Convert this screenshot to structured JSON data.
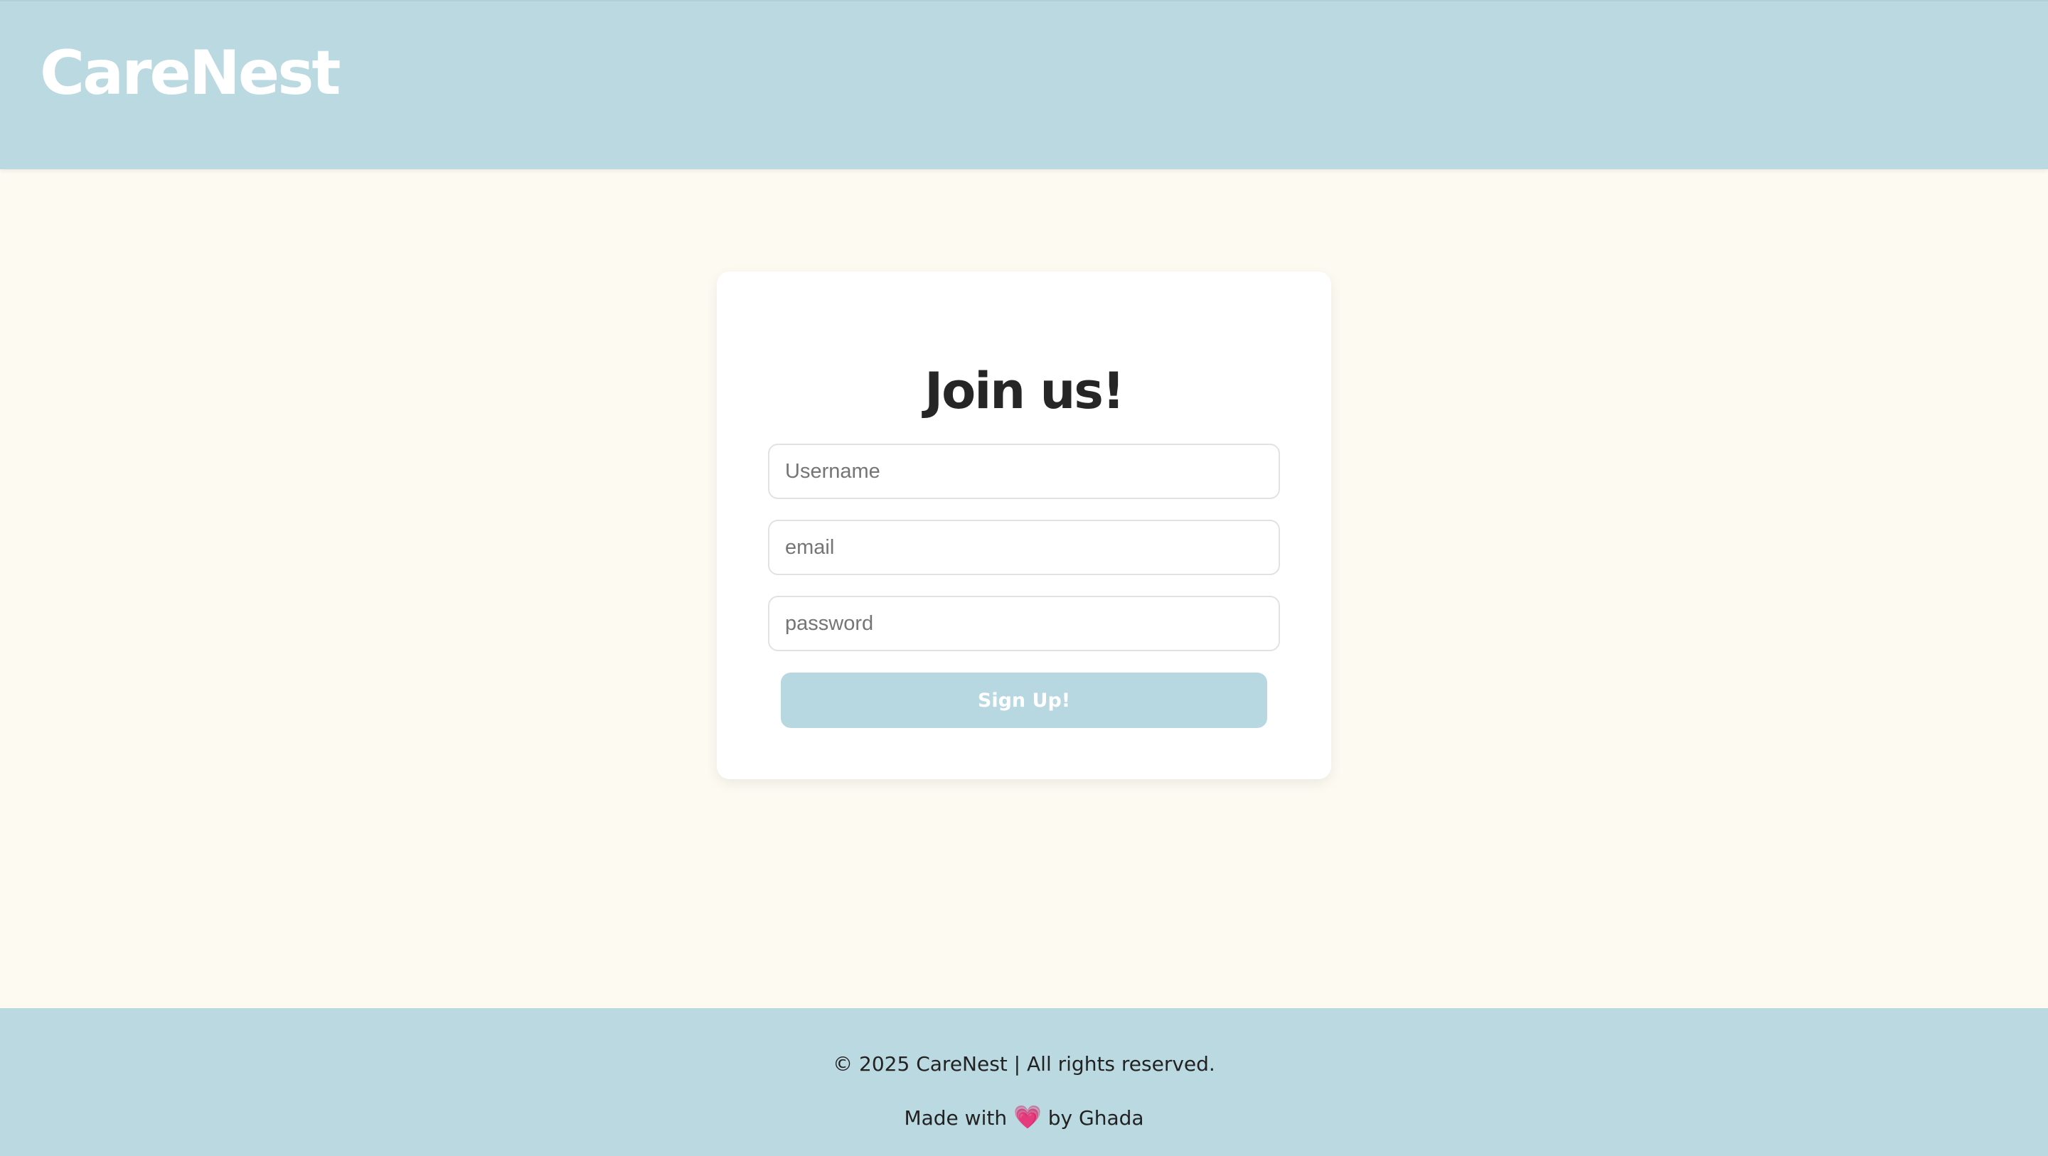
{
  "header": {
    "logo_text": "CareNest"
  },
  "form": {
    "title": "Join us!",
    "username_placeholder": "Username",
    "email_placeholder": "email",
    "password_placeholder": "password",
    "submit_label": "Sign Up!"
  },
  "footer": {
    "copyright": "© 2025 CareNest | All rights reserved.",
    "made_prefix": "Made with",
    "heart_icon": "heart-icon",
    "heart_glyph": "💗",
    "made_suffix": "by Ghada"
  },
  "colors": {
    "header_bg": "#bbd9e1",
    "page_bg": "#fdfaf2",
    "button_bg": "#b7d8e1",
    "heart": "#e04f9e"
  }
}
